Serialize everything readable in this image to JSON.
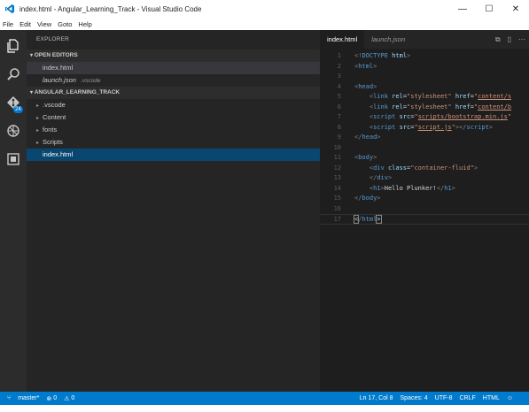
{
  "window": {
    "title": "index.html - Angular_Learning_Track - Visual Studio Code",
    "controls": [
      "—",
      "☐",
      "✕"
    ]
  },
  "menu": [
    "File",
    "Edit",
    "View",
    "Goto",
    "Help"
  ],
  "activity": {
    "git_badge": "24"
  },
  "explorer": {
    "title": "EXPLORER",
    "open_editors": {
      "header": "OPEN EDITORS",
      "items": [
        {
          "name": "index.html",
          "sub": ""
        },
        {
          "name": "launch.json",
          "sub": ".vscode"
        }
      ]
    },
    "project": {
      "header": "ANGULAR_LEARNING_TRACK",
      "items": [
        ".vscode",
        "Content",
        "fonts",
        "Scripts",
        "index.html"
      ]
    }
  },
  "editor": {
    "tabs": [
      {
        "label": "index.html",
        "active": true
      },
      {
        "label": "launch.json",
        "active": false
      }
    ],
    "lines": [
      {
        "n": "1",
        "tokens": [
          [
            "t-brkt",
            "<!"
          ],
          [
            "t-tag",
            "DOCTYPE"
          ],
          [
            "t-plain",
            " "
          ],
          [
            "t-attr",
            "html"
          ],
          [
            "t-brkt",
            ">"
          ]
        ]
      },
      {
        "n": "2",
        "tokens": [
          [
            "t-brkt",
            "<"
          ],
          [
            "t-tag",
            "html"
          ],
          [
            "t-brkt",
            ">"
          ]
        ]
      },
      {
        "n": "3",
        "tokens": []
      },
      {
        "n": "4",
        "tokens": [
          [
            "t-brkt",
            "<"
          ],
          [
            "t-tag",
            "head"
          ],
          [
            "t-brkt",
            ">"
          ]
        ]
      },
      {
        "n": "5",
        "tokens": [
          [
            "t-plain",
            "    "
          ],
          [
            "t-brkt",
            "<"
          ],
          [
            "t-tag",
            "link"
          ],
          [
            "t-plain",
            " "
          ],
          [
            "t-attr",
            "rel"
          ],
          [
            "t-plain",
            "="
          ],
          [
            "t-str",
            "\"stylesheet\""
          ],
          [
            "t-plain",
            " "
          ],
          [
            "t-attr",
            "href"
          ],
          [
            "t-plain",
            "="
          ],
          [
            "t-str",
            "\""
          ],
          [
            "t-link",
            "content/s"
          ]
        ]
      },
      {
        "n": "6",
        "tokens": [
          [
            "t-plain",
            "    "
          ],
          [
            "t-brkt",
            "<"
          ],
          [
            "t-tag",
            "link"
          ],
          [
            "t-plain",
            " "
          ],
          [
            "t-attr",
            "rel"
          ],
          [
            "t-plain",
            "="
          ],
          [
            "t-str",
            "\"stylesheet\""
          ],
          [
            "t-plain",
            " "
          ],
          [
            "t-attr",
            "href"
          ],
          [
            "t-plain",
            "="
          ],
          [
            "t-str",
            "\""
          ],
          [
            "t-link",
            "content/b"
          ]
        ]
      },
      {
        "n": "7",
        "tokens": [
          [
            "t-plain",
            "    "
          ],
          [
            "t-brkt",
            "<"
          ],
          [
            "t-tag",
            "script"
          ],
          [
            "t-plain",
            " "
          ],
          [
            "t-attr",
            "src"
          ],
          [
            "t-plain",
            "="
          ],
          [
            "t-str",
            "\""
          ],
          [
            "t-link",
            "scripts/bootstrap.min.js"
          ],
          [
            "t-str",
            "\""
          ]
        ]
      },
      {
        "n": "8",
        "tokens": [
          [
            "t-plain",
            "    "
          ],
          [
            "t-brkt",
            "<"
          ],
          [
            "t-tag",
            "script"
          ],
          [
            "t-plain",
            " "
          ],
          [
            "t-attr",
            "src"
          ],
          [
            "t-plain",
            "="
          ],
          [
            "t-str",
            "\""
          ],
          [
            "t-link",
            "script.js"
          ],
          [
            "t-str",
            "\""
          ],
          [
            "t-brkt",
            "></"
          ],
          [
            "t-tag",
            "script"
          ],
          [
            "t-brkt",
            ">"
          ]
        ]
      },
      {
        "n": "9",
        "tokens": [
          [
            "t-brkt",
            "</"
          ],
          [
            "t-tag",
            "head"
          ],
          [
            "t-brkt",
            ">"
          ]
        ]
      },
      {
        "n": "10",
        "tokens": []
      },
      {
        "n": "11",
        "tokens": [
          [
            "t-brkt",
            "<"
          ],
          [
            "t-tag",
            "body"
          ],
          [
            "t-brkt",
            ">"
          ]
        ]
      },
      {
        "n": "12",
        "tokens": [
          [
            "t-plain",
            "    "
          ],
          [
            "t-brkt",
            "<"
          ],
          [
            "t-tag",
            "div"
          ],
          [
            "t-plain",
            " "
          ],
          [
            "t-attr",
            "class"
          ],
          [
            "t-plain",
            "="
          ],
          [
            "t-str",
            "\"container-fluid\""
          ],
          [
            "t-brkt",
            ">"
          ]
        ]
      },
      {
        "n": "13",
        "tokens": [
          [
            "t-plain",
            "    "
          ],
          [
            "t-brkt",
            "</"
          ],
          [
            "t-tag",
            "div"
          ],
          [
            "t-brkt",
            ">"
          ]
        ]
      },
      {
        "n": "14",
        "tokens": [
          [
            "t-plain",
            "    "
          ],
          [
            "t-brkt",
            "<"
          ],
          [
            "t-tag",
            "h1"
          ],
          [
            "t-brkt",
            ">"
          ],
          [
            "t-plain",
            "Hello Plunker!"
          ],
          [
            "t-brkt",
            "</"
          ],
          [
            "t-tag",
            "h1"
          ],
          [
            "t-brkt",
            ">"
          ]
        ]
      },
      {
        "n": "15",
        "tokens": [
          [
            "t-brkt",
            "</"
          ],
          [
            "t-tag",
            "body"
          ],
          [
            "t-brkt",
            ">"
          ]
        ]
      },
      {
        "n": "16",
        "tokens": []
      },
      {
        "n": "17",
        "tokens": [
          [
            "t-match",
            "<"
          ],
          [
            "t-brkt",
            "/"
          ],
          [
            "t-tag",
            "html"
          ],
          [
            "t-match",
            ">"
          ]
        ]
      }
    ],
    "current_line": "17"
  },
  "status": {
    "branch": "master*",
    "errors": "0",
    "warnings": "0",
    "position": "Ln 17, Col 8",
    "spaces": "Spaces: 4",
    "encoding": "UTF-8",
    "eol": "CRLF",
    "language": "HTML"
  }
}
